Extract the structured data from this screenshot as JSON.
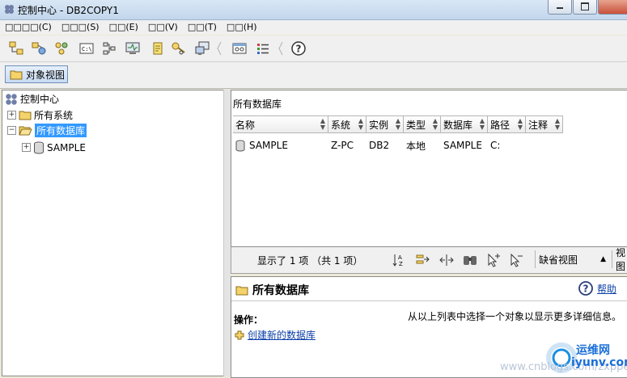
{
  "window": {
    "title": "控制中心 - DB2COPY1"
  },
  "menubar": {
    "items": [
      "□□□□(C)",
      "□□□(S)",
      "□□(E)",
      "□□(V)",
      "□□(T)",
      "□□(H)"
    ]
  },
  "toolbar": {
    "icons": [
      "system-objects-icon",
      "connect-icon",
      "network-icon",
      "command-editor-icon",
      "task-center-icon",
      "health-center-icon",
      "journal-icon",
      "license-icon",
      "replication-icon",
      "tools-settings-icon",
      "legend-icon",
      "help-icon"
    ]
  },
  "toolbar2": {
    "object_view_label": "对象视图"
  },
  "tree": {
    "root": "控制中心",
    "items": [
      {
        "label": "所有系统"
      },
      {
        "label": "所有数据库"
      },
      {
        "label": "SAMPLE"
      }
    ]
  },
  "list": {
    "title": "所有数据库",
    "columns": [
      "名称",
      "系统",
      "实例",
      "类型",
      "数据库",
      "路径",
      "注释"
    ],
    "rows": [
      {
        "name": "SAMPLE",
        "system": "Z-PC",
        "instance": "DB2",
        "type": "本地",
        "database": "SAMPLE",
        "path": "C:",
        "comment": ""
      }
    ]
  },
  "status": {
    "text": "显示了 1 项 （共 1 项）",
    "view": "缺省视图",
    "view2": "视图"
  },
  "detail": {
    "title": "所有数据库",
    "help_label": "帮助",
    "operations_label": "操作：",
    "hint": "从以上列表中选择一个对象以显示更多详细信息。",
    "create_link": "创建新的数据库"
  },
  "watermark": {
    "url": "www.cnblogs.com/zxppe",
    "logo_cn": "运维网",
    "logo_en": "iyunv.com"
  }
}
